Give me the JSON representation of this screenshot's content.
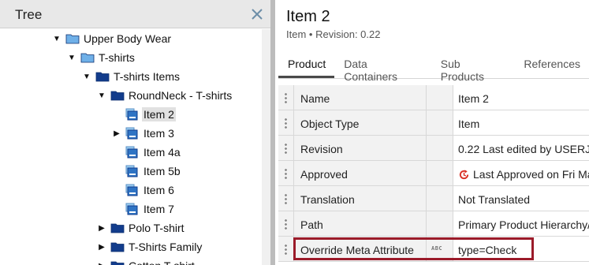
{
  "tree": {
    "title": "Tree",
    "nodes": [
      {
        "label": "Upper Body Wear",
        "arrow": "down",
        "icon": "folder-light",
        "selected": false
      },
      {
        "label": "T-shirts",
        "arrow": "down",
        "icon": "folder-light",
        "selected": false
      },
      {
        "label": "T-shirts Items",
        "arrow": "down",
        "icon": "folder-dark",
        "selected": false
      },
      {
        "label": "RoundNeck - T-shirts",
        "arrow": "down",
        "icon": "folder-dark",
        "selected": false
      },
      {
        "label": "Item 2",
        "arrow": "none",
        "icon": "product",
        "selected": true
      },
      {
        "label": "Item 3",
        "arrow": "right",
        "icon": "product",
        "selected": false
      },
      {
        "label": "Item 4a",
        "arrow": "none",
        "icon": "product",
        "selected": false
      },
      {
        "label": "Item 5b",
        "arrow": "none",
        "icon": "product",
        "selected": false
      },
      {
        "label": "Item 6",
        "arrow": "none",
        "icon": "product",
        "selected": false
      },
      {
        "label": "Item 7",
        "arrow": "none",
        "icon": "product",
        "selected": false
      },
      {
        "label": "Polo T-shirt",
        "arrow": "right",
        "icon": "folder-dark",
        "selected": false
      },
      {
        "label": "T-Shirts Family",
        "arrow": "right",
        "icon": "folder-dark",
        "selected": false
      },
      {
        "label": "Cotton T-shirt",
        "arrow": "right",
        "icon": "folder-dark",
        "selected": false
      }
    ]
  },
  "details": {
    "title": "Item 2",
    "object_type": "Item",
    "revision_label": "Revision: 0.22",
    "tabs": [
      {
        "label": "Product",
        "active": true
      },
      {
        "label": "Data Containers",
        "active": false
      },
      {
        "label": "Sub Products",
        "active": false
      },
      {
        "label": "References",
        "active": false
      }
    ],
    "rows": [
      {
        "name": "Name",
        "value": "Item 2",
        "type_badge": ""
      },
      {
        "name": "Object Type",
        "value": "Item",
        "type_badge": ""
      },
      {
        "name": "Revision",
        "value": "0.22 Last edited by USERJ",
        "type_badge": ""
      },
      {
        "name": "Approved",
        "value": "Last Approved on Fri Ma",
        "type_badge": "",
        "status_icon": "refresh-red-icon"
      },
      {
        "name": "Translation",
        "value": "Not Translated",
        "type_badge": ""
      },
      {
        "name": "Path",
        "value": "Primary Product Hierarchy/",
        "type_badge": ""
      },
      {
        "name": "Override Meta Attribute",
        "value": "type=Check",
        "type_badge": "ABC"
      }
    ]
  },
  "colors": {
    "highlight_border": "#9b1b2a",
    "folder_light": "#6fb0e8",
    "folder_dark": "#123c8c",
    "status_red": "#d93025"
  }
}
